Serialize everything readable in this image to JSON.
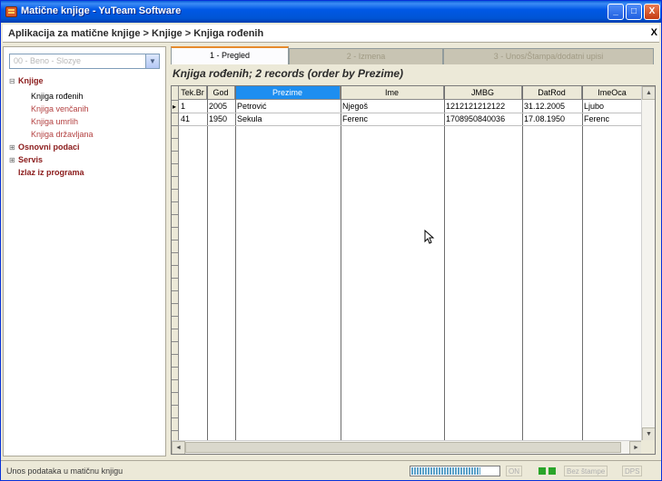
{
  "window": {
    "title": "Matične knjige - YuTeam Software",
    "icon": "app-book-icon",
    "controls": {
      "minimize": "_",
      "maximize": "□",
      "close": "X"
    }
  },
  "breadcrumb": {
    "text": "Aplikacija za matične knjige > Knjige > Knjiga rođenih",
    "close": "X"
  },
  "sidebar": {
    "combo": {
      "value": "00 - Beno - Slozye"
    },
    "tree": [
      {
        "label": "Knjige",
        "level": 0,
        "expander": "−",
        "bold": true
      },
      {
        "label": "Knjiga rođenih",
        "level": 1,
        "selected": true
      },
      {
        "label": "Knjiga venčanih",
        "level": 1
      },
      {
        "label": "Knjiga umrlih",
        "level": 1
      },
      {
        "label": "Knjiga državljana",
        "level": 1
      },
      {
        "label": "Osnovni podaci",
        "level": 0,
        "expander": "+",
        "bold": true
      },
      {
        "label": "Servis",
        "level": 0,
        "expander": "+",
        "bold": true
      },
      {
        "label": "Izlaz iz programa",
        "level": 0,
        "expander": "",
        "bold": true
      }
    ]
  },
  "tabs": [
    {
      "label": "1 - Pregled",
      "active": true
    },
    {
      "label": "2 - Izmena",
      "active": false
    },
    {
      "label": "3 - Unos/Štampa/dodatni upisi",
      "active": false
    }
  ],
  "grid": {
    "caption": "Knjiga rođenih; 2 records (order by Prezime)",
    "columns": [
      "Tek.Br",
      "God",
      "Prezime",
      "Ime",
      "JMBG",
      "DatRod",
      "ImeOca"
    ],
    "sorted_column": "Prezime",
    "rows": [
      [
        "1",
        "2005",
        "Petrović",
        "Njegoš",
        "1212121212122",
        "31.12.2005",
        "Ljubo"
      ],
      [
        "41",
        "1950",
        "Sekula",
        "Ferenc",
        "1708950840036",
        "17.08.1950",
        "Ferenc"
      ]
    ],
    "current_row": 0
  },
  "status": {
    "text": "Unos podataka u matičnu knjigu",
    "progress": 0.78,
    "cells": [
      "ON",
      "Bez štampe",
      "DPS"
    ],
    "led_colors": [
      "#2aa52a",
      "#2aa52a"
    ]
  }
}
